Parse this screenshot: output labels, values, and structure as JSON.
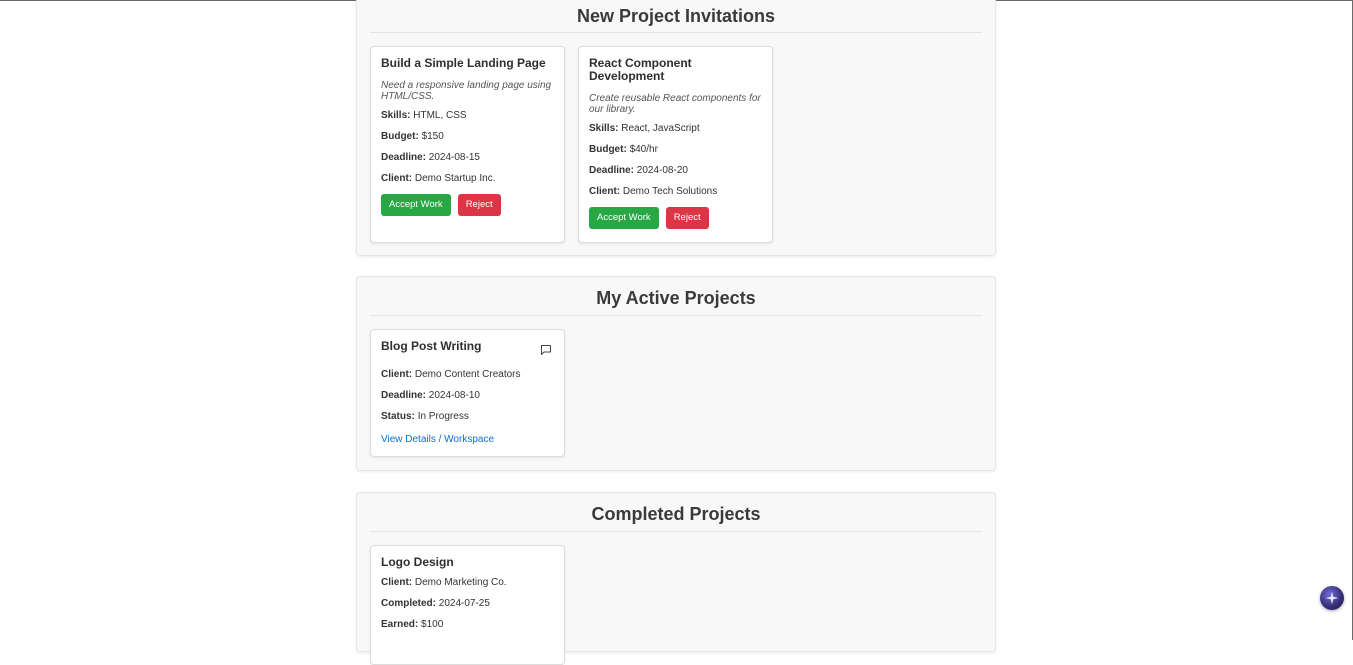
{
  "invitations": {
    "title": "New Project Invitations",
    "cards": [
      {
        "title": "Build a Simple Landing Page",
        "description": "Need a responsive landing page using HTML/CSS.",
        "skills_label": "Skills:",
        "skills": "HTML, CSS",
        "budget_label": "Budget:",
        "budget": "$150",
        "deadline_label": "Deadline:",
        "deadline": "2024-08-15",
        "client_label": "Client:",
        "client": "Demo Startup Inc.",
        "accept_label": "Accept Work",
        "reject_label": "Reject"
      },
      {
        "title": "React Component Development",
        "description": "Create reusable React components for our library.",
        "skills_label": "Skills:",
        "skills": "React, JavaScript",
        "budget_label": "Budget:",
        "budget": "$40/hr",
        "deadline_label": "Deadline:",
        "deadline": "2024-08-20",
        "client_label": "Client:",
        "client": "Demo Tech Solutions",
        "accept_label": "Accept Work",
        "reject_label": "Reject"
      }
    ]
  },
  "active": {
    "title": "My Active Projects",
    "cards": [
      {
        "title": "Blog Post Writing",
        "client_label": "Client:",
        "client": "Demo Content Creators",
        "deadline_label": "Deadline:",
        "deadline": "2024-08-10",
        "status_label": "Status:",
        "status": "In Progress",
        "link_label": "View Details / Workspace",
        "icon": "chat-icon"
      }
    ]
  },
  "completed": {
    "title": "Completed Projects",
    "cards": [
      {
        "title": "Logo Design",
        "client_label": "Client:",
        "client": "Demo Marketing Co.",
        "completed_label": "Completed:",
        "completed": "2024-07-25",
        "earned_label": "Earned:",
        "earned": "$100"
      }
    ]
  },
  "assistant_button": {
    "icon": "sparkle-icon"
  },
  "colors": {
    "accept": "#28a745",
    "reject": "#dc3545",
    "link": "#0b6fd6",
    "section_bg": "#f8f8f8"
  }
}
